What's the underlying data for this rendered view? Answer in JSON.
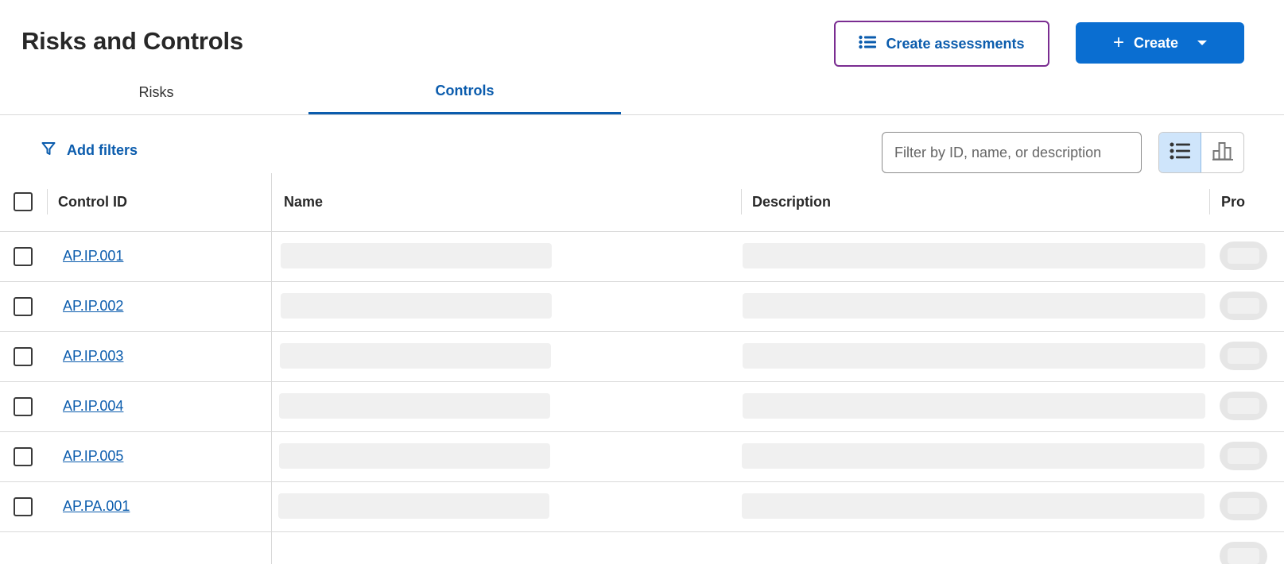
{
  "page": {
    "title": "Risks and Controls"
  },
  "header": {
    "create_assessments_label": "Create assessments",
    "create_label": "Create"
  },
  "tabs": [
    {
      "label": "Risks",
      "active": false
    },
    {
      "label": "Controls",
      "active": true
    }
  ],
  "toolbar": {
    "add_filters_label": "Add filters",
    "search_placeholder": "Filter by ID, name, or description",
    "view_modes": [
      "list-icon",
      "chart-icon"
    ],
    "active_view": "list"
  },
  "table": {
    "columns": [
      "Control ID",
      "Name",
      "Description",
      "Pro"
    ],
    "rows": [
      {
        "control_id": "AP.IP.001"
      },
      {
        "control_id": "AP.IP.002"
      },
      {
        "control_id": "AP.IP.003"
      },
      {
        "control_id": "AP.IP.004"
      },
      {
        "control_id": "AP.IP.005"
      },
      {
        "control_id": "AP.PA.001"
      }
    ]
  },
  "colors": {
    "accent": "#0b5cad",
    "primary_button": "#0a6ed1",
    "focus_outline": "#7a2d91",
    "skeleton": "#f0f0f0"
  }
}
